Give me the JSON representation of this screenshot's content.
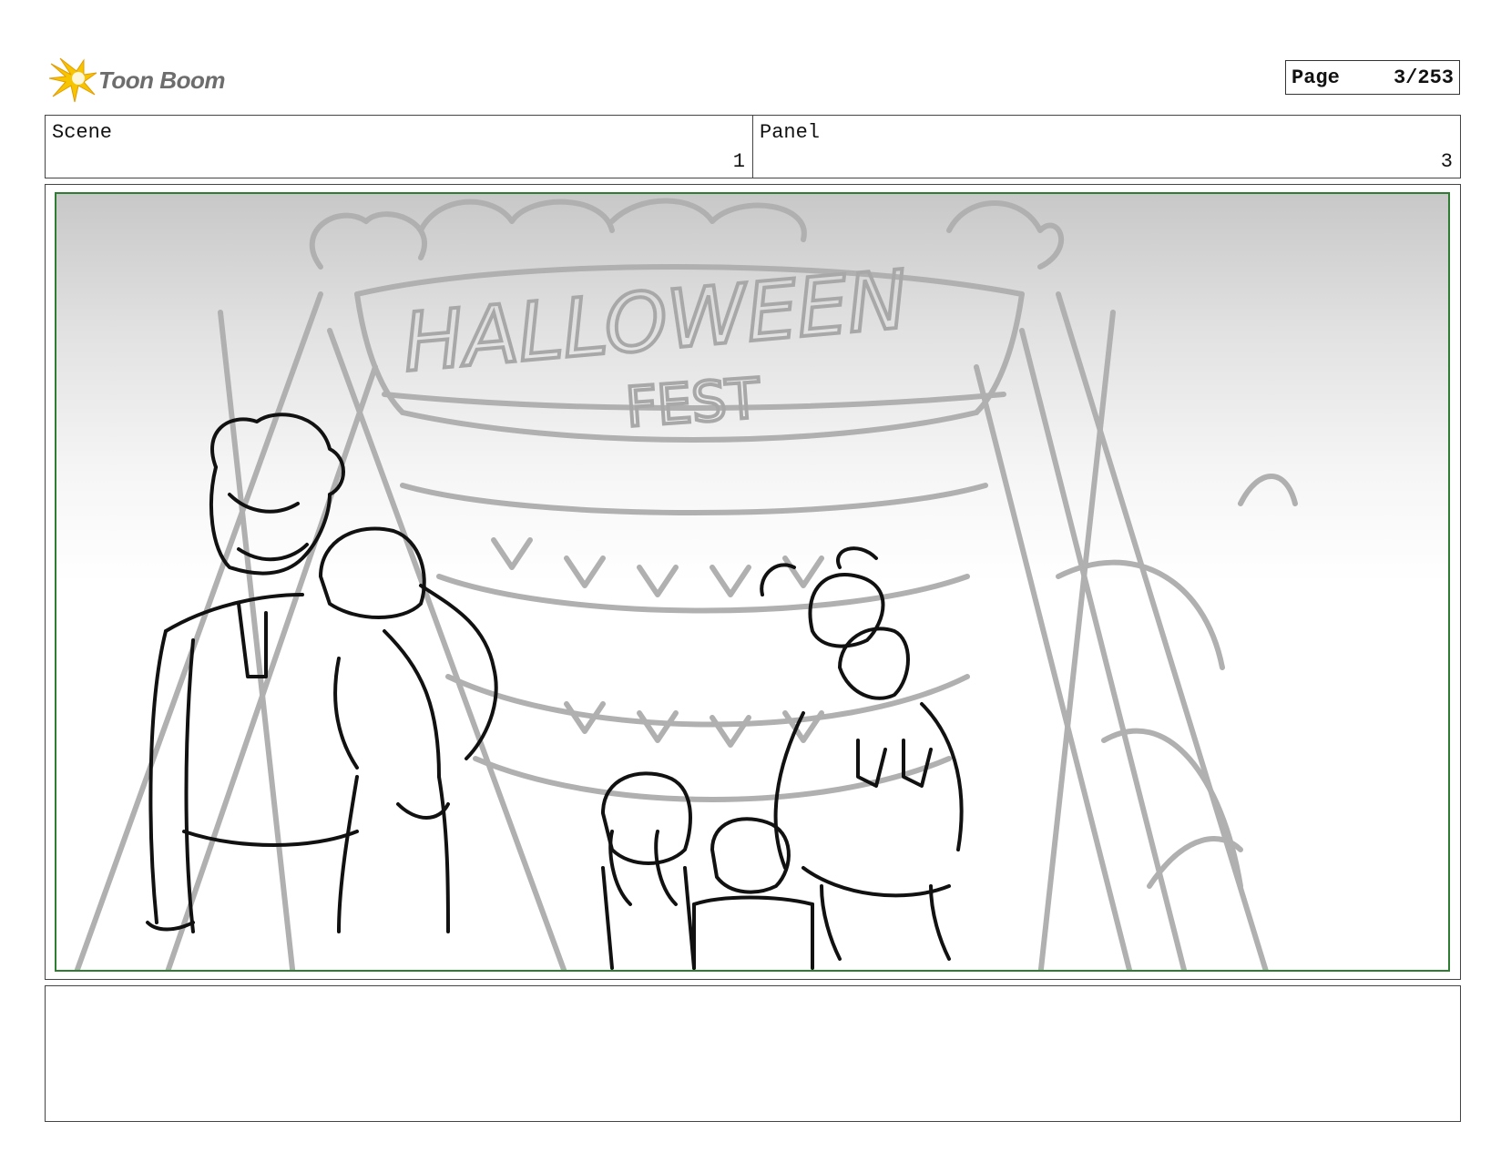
{
  "brand": {
    "name": "Toon Boom",
    "logo_icon": "burst-star-icon",
    "accent": "#f5b800"
  },
  "page": {
    "label": "Page",
    "current": "3/253"
  },
  "scene": {
    "label": "Scene",
    "value": "1"
  },
  "panel": {
    "label": "Panel",
    "value": "3"
  },
  "drawing": {
    "sign_line1": "HALLOWEEN",
    "sign_line2": "FEST",
    "frame_color": "#2e7d32"
  },
  "notes": {
    "text": ""
  }
}
